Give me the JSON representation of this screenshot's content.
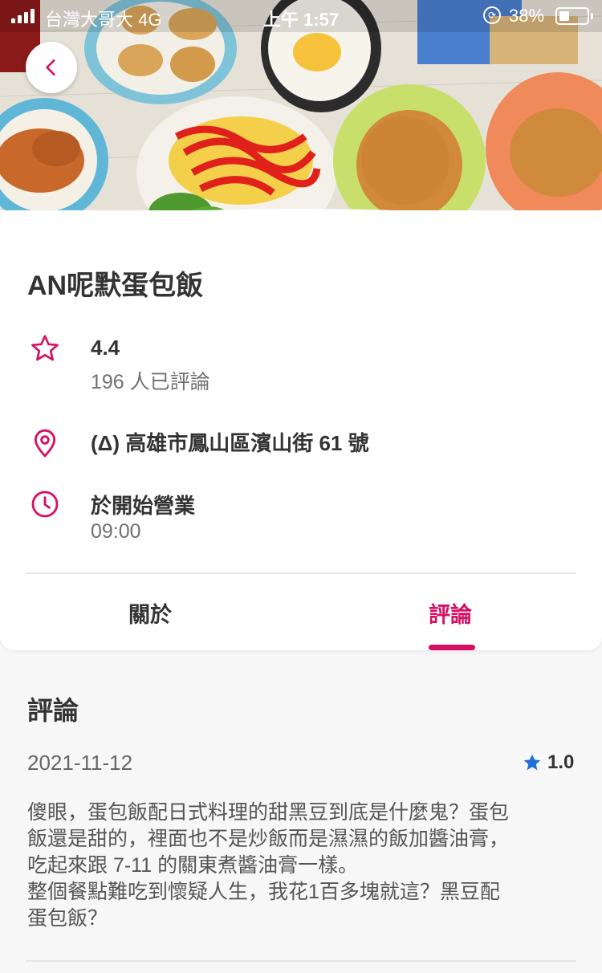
{
  "status_bar": {
    "carrier": "台灣大哥大",
    "network": "4G",
    "time": "上午 1:57",
    "battery": "38%"
  },
  "restaurant": {
    "name": "AN呢默蛋包飯",
    "rating": "4.4",
    "review_count": "196 人已評論",
    "address": "(Δ) 高雄市鳳山區濱山街 61 號",
    "hours_label": "於開始營業",
    "hours_time": "09:00"
  },
  "tabs": {
    "about": "關於",
    "reviews": "評論",
    "active": "reviews"
  },
  "reviews": {
    "heading": "評論",
    "items": [
      {
        "date": "2021-11-12",
        "rating": "1.0",
        "lines": [
          "傻眼，蛋包飯配日式料理的甜黑豆到底是什麼鬼？蛋包",
          "飯還是甜的，裡面也不是炒飯而是濕濕的飯加醬油膏，",
          "吃起來跟 7-11 的關東煮醬油膏一樣。",
          "整個餐點難吃到懷疑人生，我花1百多塊就這？黑豆配",
          "蛋包飯？"
        ]
      }
    ]
  },
  "colors": {
    "accent": "#d70f64",
    "star_blue": "#1e6fd9"
  },
  "icons": {
    "back": "chevron-left-icon",
    "rating": "star-outline-icon",
    "address": "location-pin-icon",
    "hours": "clock-icon",
    "review_star": "star-filled-icon"
  }
}
